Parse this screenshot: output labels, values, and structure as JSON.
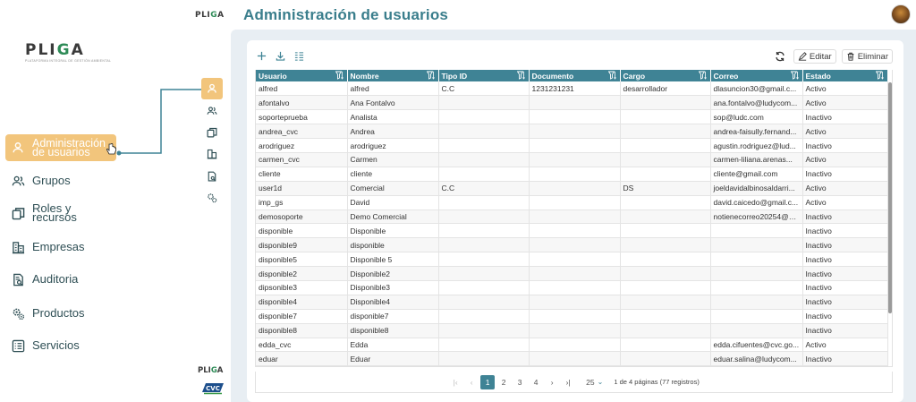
{
  "app": {
    "logo_text": "PLIGA",
    "logo_tagline": "PLATAFORMA INTEGRAL DE GESTIÓN AMBIENTAL",
    "partner_logo": "CVC"
  },
  "header": {
    "title": "Administración de usuarios"
  },
  "menu": {
    "items": [
      {
        "label": "Administración de usuarios",
        "icon": "user-icon",
        "active": true
      },
      {
        "label": "Grupos",
        "icon": "users-icon"
      },
      {
        "label": "Roles y recursos",
        "icon": "copy-icon"
      },
      {
        "label": "Empresas",
        "icon": "building-icon"
      },
      {
        "label": "Auditoria",
        "icon": "audit-icon"
      },
      {
        "label": "Productos",
        "icon": "gears-icon"
      },
      {
        "label": "Servicios",
        "icon": "list-icon"
      }
    ]
  },
  "toolbar": {
    "add_icon": "plus-icon",
    "download_icon": "download-icon",
    "columns_icon": "columns-icon",
    "refresh_icon": "refresh-icon",
    "edit_label": "Editar",
    "delete_label": "Eliminar"
  },
  "table": {
    "columns": [
      "Usuario",
      "Nombre",
      "Tipo ID",
      "Documento",
      "Cargo",
      "Correo",
      "Estado"
    ],
    "rows": [
      [
        "alfred",
        "alfred",
        "C.C",
        "1231231231",
        "desarrollador",
        "dlasuncion30@gmail.c...",
        "Activo"
      ],
      [
        "afontalvo",
        "Ana Fontalvo",
        "",
        "",
        "",
        "ana.fontalvo@ludycom...",
        "Activo"
      ],
      [
        "soporteprueba",
        "Analista",
        "",
        "",
        "",
        "sop@ludc.com",
        "Inactivo"
      ],
      [
        "andrea_cvc",
        "Andrea",
        "",
        "",
        "",
        "andrea-faisully.fernand...",
        "Activo"
      ],
      [
        "arodriguez",
        "arodriguez",
        "",
        "",
        "",
        "agustin.rodriguez@lud...",
        "Inactivo"
      ],
      [
        "carmen_cvc",
        "Carmen",
        "",
        "",
        "",
        "carmen-liliana.arenas...",
        "Activo"
      ],
      [
        "cliente",
        "cliente",
        "",
        "",
        "",
        "cliente@gmail.com",
        "Inactivo"
      ],
      [
        "user1d",
        "Comercial",
        "C.C",
        "",
        "DS",
        "joeldavidalbinosaldarri...",
        "Activo"
      ],
      [
        "imp_gs",
        "David",
        "",
        "",
        "",
        "david.caicedo@gmail.c...",
        "Activo"
      ],
      [
        "demosoporte",
        "Demo Comercial",
        "",
        "",
        "",
        "notienecorreo20254@g...",
        "Inactivo"
      ],
      [
        "disponible",
        "Disponible",
        "",
        "",
        "",
        "",
        "Inactivo"
      ],
      [
        "disponible9",
        "disponible",
        "",
        "",
        "",
        "",
        "Inactivo"
      ],
      [
        "disponible5",
        "Disponible 5",
        "",
        "",
        "",
        "",
        "Inactivo"
      ],
      [
        "disponible2",
        "Disponible2",
        "",
        "",
        "",
        "",
        "Inactivo"
      ],
      [
        "dipsonible3",
        "Disponible3",
        "",
        "",
        "",
        "",
        "Inactivo"
      ],
      [
        "disponible4",
        "Disponible4",
        "",
        "",
        "",
        "",
        "Inactivo"
      ],
      [
        "disponible7",
        "disponible7",
        "",
        "",
        "",
        "",
        "Inactivo"
      ],
      [
        "disponible8",
        "disponible8",
        "",
        "",
        "",
        "",
        "Inactivo"
      ],
      [
        "edda_cvc",
        "Edda",
        "",
        "",
        "",
        "edda.cifuentes@cvc.go...",
        "Activo"
      ],
      [
        "eduar",
        "Eduar",
        "",
        "",
        "",
        "eduar.salina@ludycom...",
        "Inactivo"
      ]
    ]
  },
  "paginator": {
    "pages": [
      "1",
      "2",
      "3",
      "4"
    ],
    "current_page": "1",
    "rows_per_page": "25",
    "report": "1 de 4 páginas (77 registros)"
  }
}
